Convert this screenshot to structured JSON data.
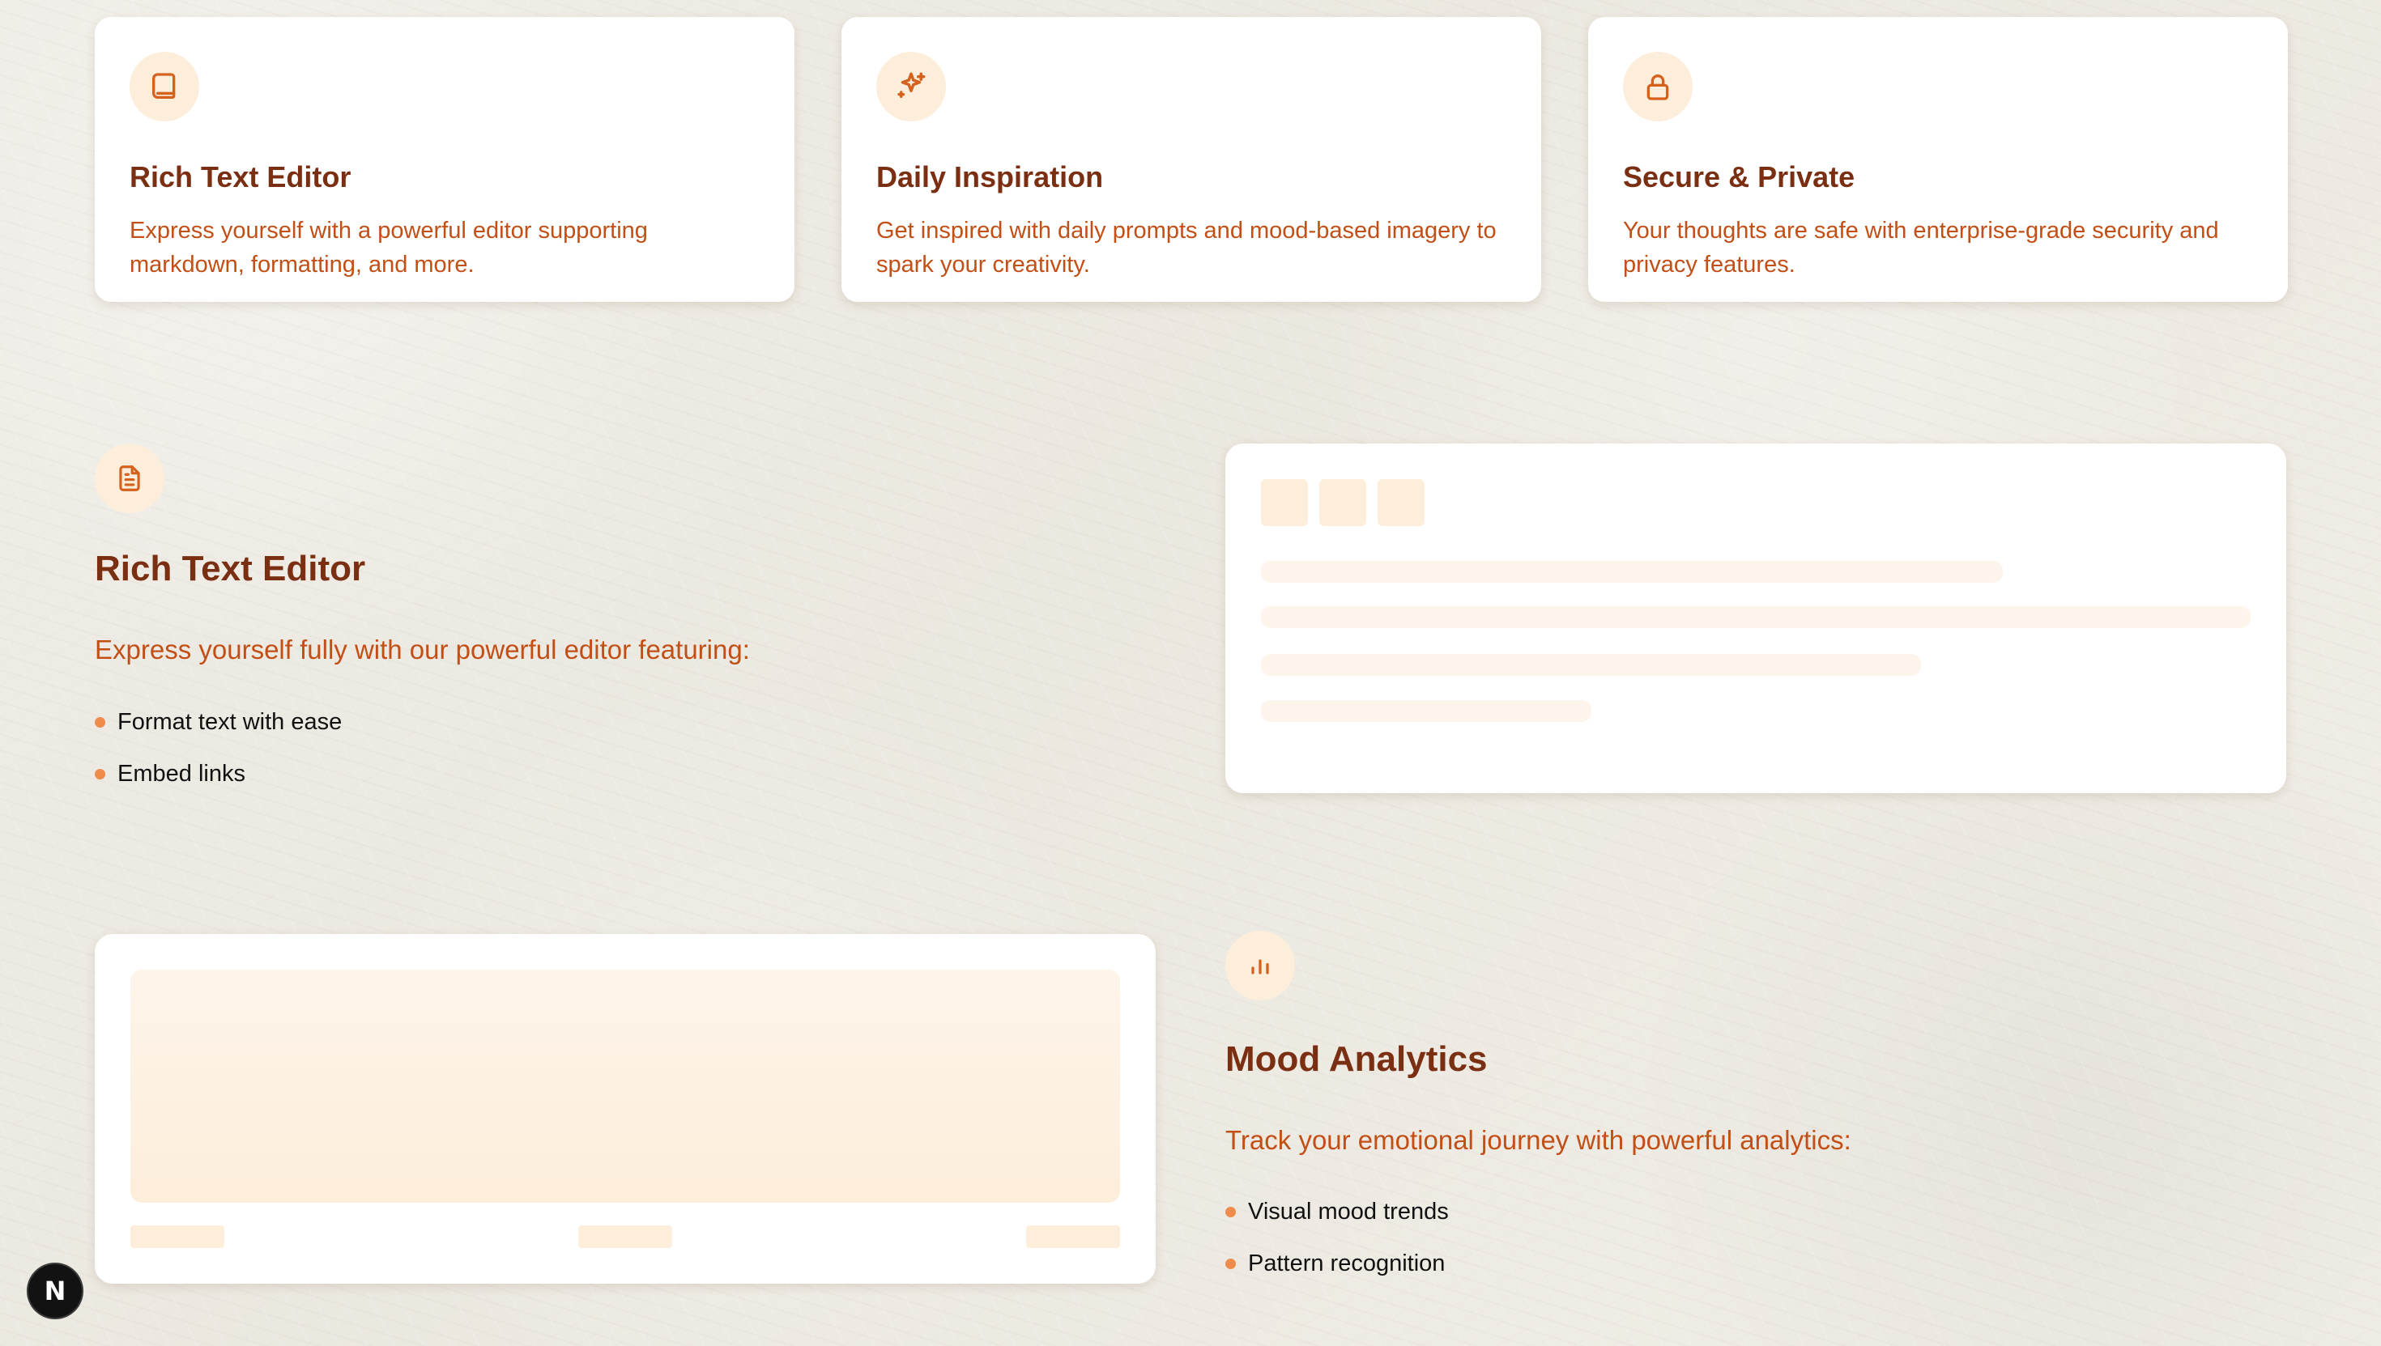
{
  "feature_cards": [
    {
      "title": "Rich Text Editor",
      "description": "Express yourself with a powerful editor supporting markdown, formatting, and more.",
      "icon": "book-icon"
    },
    {
      "title": "Daily Inspiration",
      "description": "Get inspired with daily prompts and mood-based imagery to spark your creativity.",
      "icon": "sparkles-icon"
    },
    {
      "title": "Secure & Private",
      "description": "Your thoughts are safe with enterprise-grade security and privacy features.",
      "icon": "lock-icon"
    }
  ],
  "sections": {
    "editor": {
      "title": "Rich Text Editor",
      "intro": "Express yourself fully with our powerful editor featuring:",
      "items": [
        "Format text with ease",
        "Embed links"
      ],
      "icon": "document-icon"
    },
    "analytics": {
      "title": "Mood Analytics",
      "intro": "Track your emotional journey with powerful analytics:",
      "items": [
        "Visual mood trends",
        "Pattern recognition"
      ],
      "icon": "bar-chart-icon"
    }
  },
  "badge": {
    "label": "N",
    "icon": "nextjs-icon"
  },
  "colors": {
    "title": "#7a2f13",
    "body": "#c24f16",
    "accent": "#ef8b4b",
    "soft": "#fdeedb"
  }
}
